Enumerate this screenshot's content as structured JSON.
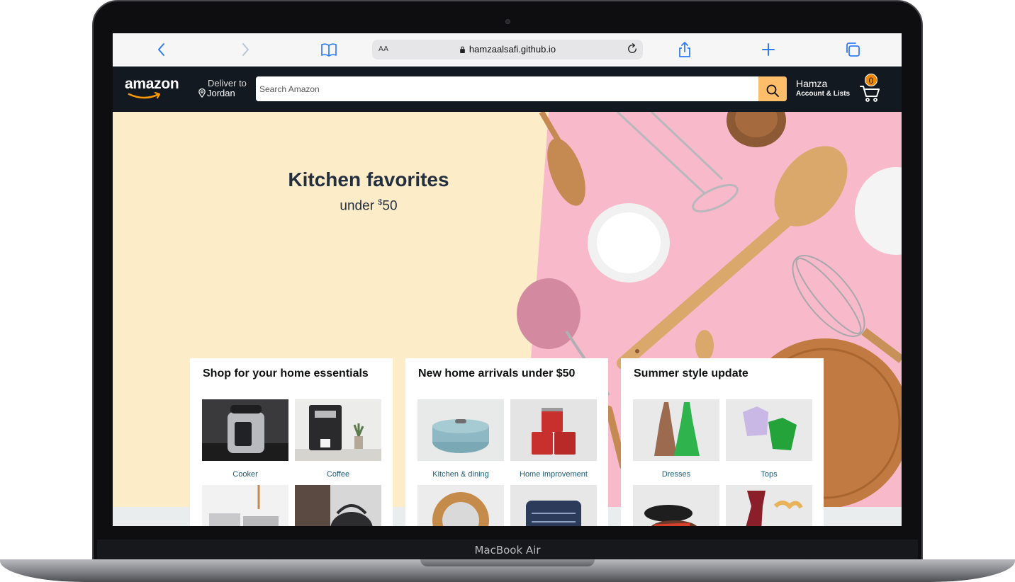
{
  "device": {
    "label": "MacBook Air"
  },
  "browser": {
    "text_size_label": "AA",
    "url": "hamzaalsafi.github.io",
    "icons": [
      "back-icon",
      "forward-icon",
      "bookmarks-icon",
      "reload-icon",
      "share-icon",
      "new-tab-icon",
      "tabs-icon"
    ],
    "accent": "#2f7df6"
  },
  "header": {
    "logo": "amazon",
    "deliver_label": "Deliver to",
    "deliver_location": "Jordan",
    "search_placeholder": "Search Amazon",
    "account_name": "Hamza",
    "account_sub": "Account & Lists",
    "cart_count": "0",
    "colors": {
      "bar": "#131921",
      "search_button": "#febd69",
      "cart_badge": "#f08804"
    }
  },
  "hero": {
    "title": "Kitchen favorites",
    "subtitle_prefix": "under ",
    "subtitle_currency": "$",
    "subtitle_amount": "50",
    "colors": {
      "left": "#fdecc8",
      "right": "#f8b9cb"
    }
  },
  "cards": [
    {
      "title": "Shop for your home essentials",
      "tiles": [
        {
          "label": "Cooker"
        },
        {
          "label": "Coffee"
        },
        {
          "label": ""
        },
        {
          "label": ""
        }
      ]
    },
    {
      "title": "New home arrivals under $50",
      "tiles": [
        {
          "label": "Kitchen & dining"
        },
        {
          "label": "Home improvement"
        },
        {
          "label": ""
        },
        {
          "label": ""
        }
      ]
    },
    {
      "title": "Summer style update",
      "tiles": [
        {
          "label": "Dresses"
        },
        {
          "label": "Tops"
        },
        {
          "label": ""
        },
        {
          "label": ""
        }
      ]
    }
  ]
}
